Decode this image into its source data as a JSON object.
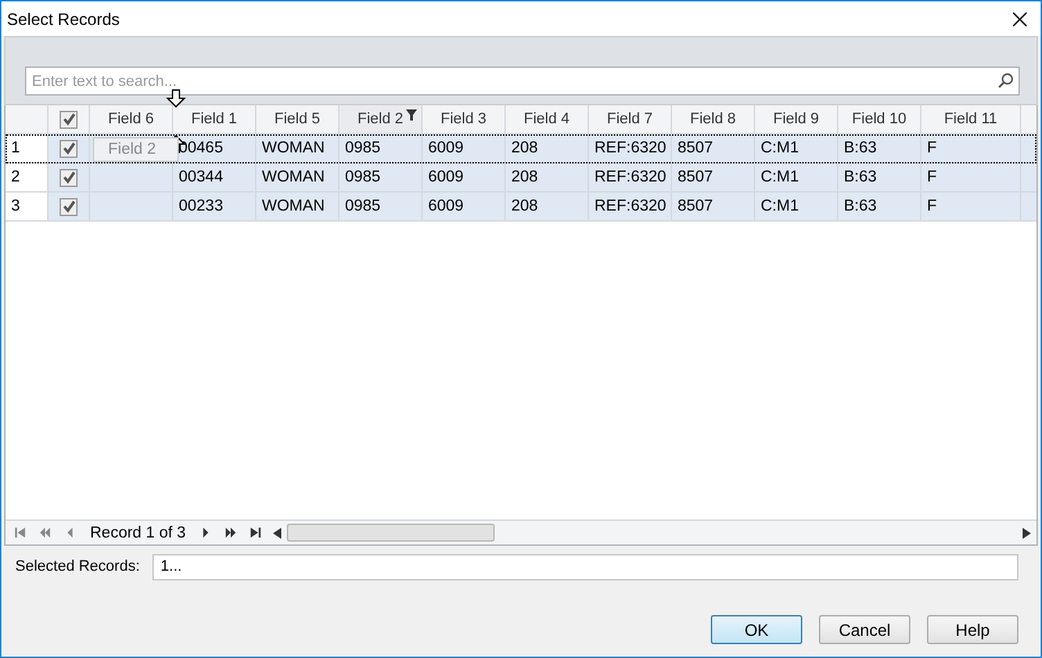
{
  "window": {
    "title": "Select Records"
  },
  "search": {
    "placeholder": "Enter text to search..."
  },
  "table": {
    "header_checked": true,
    "columns": [
      {
        "label": "Field 6",
        "filtered": false
      },
      {
        "label": "Field 1",
        "filtered": false
      },
      {
        "label": "Field 5",
        "filtered": false
      },
      {
        "label": "Field 2",
        "filtered": true
      },
      {
        "label": "Field 3",
        "filtered": false
      },
      {
        "label": "Field 4",
        "filtered": false
      },
      {
        "label": "Field 7",
        "filtered": false
      },
      {
        "label": "Field 8",
        "filtered": false
      },
      {
        "label": "Field 9",
        "filtered": false
      },
      {
        "label": "Field 10",
        "filtered": false
      },
      {
        "label": "Field 11",
        "filtered": false
      }
    ],
    "rows": [
      {
        "number": "1",
        "checked": true,
        "selected": true,
        "cells": [
          "",
          "00465",
          "WOMAN",
          "0985",
          "6009",
          "208",
          "REF:6320",
          "8507",
          "C:M1",
          "B:63",
          "F"
        ]
      },
      {
        "number": "2",
        "checked": true,
        "selected": false,
        "cells": [
          "",
          "00344",
          "WOMAN",
          "0985",
          "6009",
          "208",
          "REF:6320",
          "8507",
          "C:M1",
          "B:63",
          "F"
        ]
      },
      {
        "number": "3",
        "checked": true,
        "selected": false,
        "cells": [
          "",
          "00233",
          "WOMAN",
          "0985",
          "6009",
          "208",
          "REF:6320",
          "8507",
          "C:M1",
          "B:63",
          "F"
        ]
      }
    ],
    "drag_column": "Field 2"
  },
  "navigator": {
    "text": "Record 1 of 3"
  },
  "selected_records": {
    "label": "Selected Records:",
    "value": "1..."
  },
  "buttons": [
    {
      "label": "OK",
      "default": true
    },
    {
      "label": "Cancel",
      "default": false
    },
    {
      "label": "Help",
      "default": false
    }
  ]
}
